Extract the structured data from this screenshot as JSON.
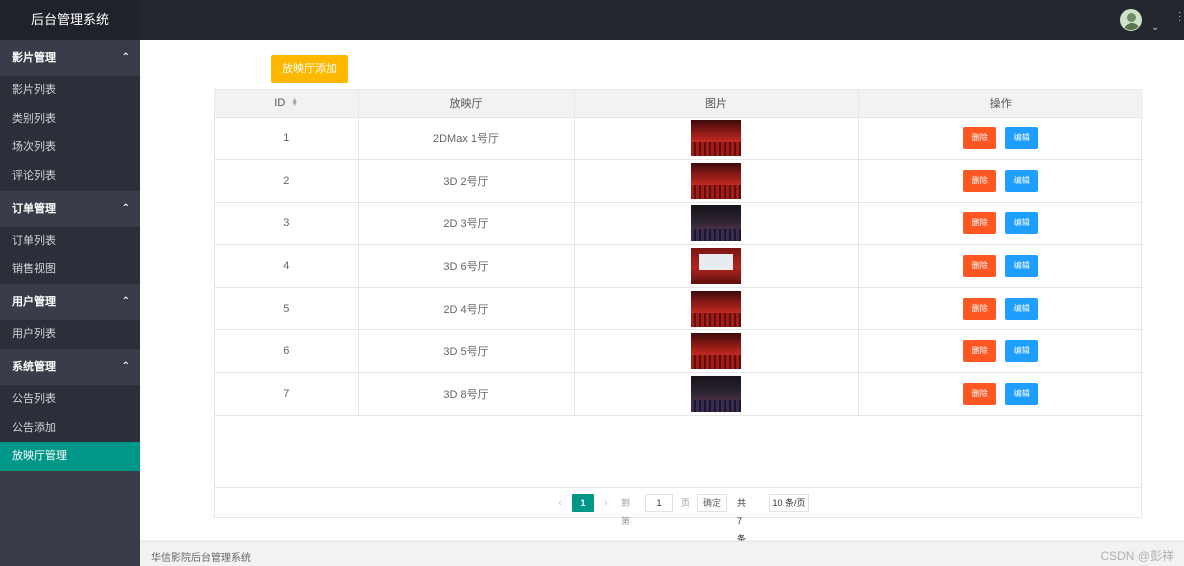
{
  "header": {
    "app_title": "后台管理系统"
  },
  "sidebar": {
    "groups": [
      {
        "title": "影片管理",
        "items": [
          "影片列表",
          "类别列表",
          "场次列表",
          "评论列表"
        ]
      },
      {
        "title": "订单管理",
        "items": [
          "订单列表",
          "销售视图"
        ]
      },
      {
        "title": "用户管理",
        "items": [
          "用户列表"
        ]
      },
      {
        "title": "系统管理",
        "items": [
          "公告列表",
          "公告添加",
          "放映厅管理"
        ]
      }
    ],
    "active_item": "放映厅管理"
  },
  "toolbar": {
    "add_label": "放映厅添加"
  },
  "table": {
    "headers": [
      "ID",
      "放映厅",
      "图片",
      "操作"
    ],
    "delete_label": "删除",
    "edit_label": "编辑",
    "rows": [
      {
        "id": "1",
        "hall": "2DMax 1号厅",
        "image": "red-theater-photo"
      },
      {
        "id": "2",
        "hall": "3D 2号厅",
        "image": "red-theater-photo"
      },
      {
        "id": "3",
        "hall": "2D 3号厅",
        "image": "dark-theater-photo"
      },
      {
        "id": "4",
        "hall": "3D 6号厅",
        "image": "screen-theater-photo"
      },
      {
        "id": "5",
        "hall": "2D 4号厅",
        "image": "red-theater-photo"
      },
      {
        "id": "6",
        "hall": "3D 5号厅",
        "image": "red-theater-photo"
      },
      {
        "id": "7",
        "hall": "3D 8号厅",
        "image": "dark-theater-photo"
      }
    ]
  },
  "pagination": {
    "current": "1",
    "goto_label": "到第",
    "goto_value": "1",
    "page_label": "页",
    "confirm_label": "确定",
    "total_label": "共 7 条",
    "page_size_label": "10 条/页"
  },
  "footer": {
    "text": "华信影院后台管理系统",
    "watermark": "CSDN @彭祥"
  },
  "colors": {
    "header_bg": "#23262e",
    "sidebar_bg": "#393d49",
    "active_bg": "#009688",
    "add_button": "#ffb800",
    "delete_button": "#ff5722",
    "edit_button": "#1e9fff"
  }
}
